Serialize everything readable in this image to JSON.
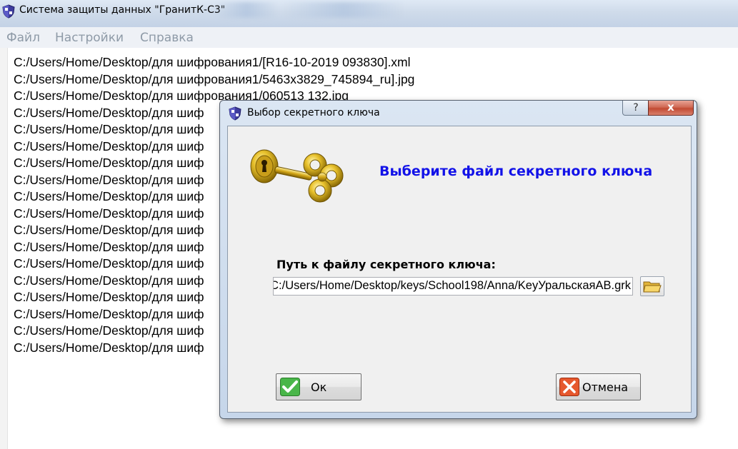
{
  "window": {
    "title": "Система защиты данных \"ГранитК-С3\""
  },
  "menu": [
    {
      "label": "Файл"
    },
    {
      "label": "Настройки"
    },
    {
      "label": "Справка"
    }
  ],
  "files": [
    "C:/Users/Home/Desktop/для шифрования1/[R16-10-2019 093830].xml",
    "C:/Users/Home/Desktop/для шифрования1/5463x3829_745894_ru].jpg",
    "C:/Users/Home/Desktop/для шифрования1/060513 132.jpg",
    "C:/Users/Home/Desktop/для шиф",
    "C:/Users/Home/Desktop/для шиф",
    "C:/Users/Home/Desktop/для шиф",
    "C:/Users/Home/Desktop/для шиф",
    "C:/Users/Home/Desktop/для шиф",
    "C:/Users/Home/Desktop/для шиф",
    "C:/Users/Home/Desktop/для шиф",
    "C:/Users/Home/Desktop/для шиф",
    "C:/Users/Home/Desktop/для шиф",
    "C:/Users/Home/Desktop/для шиф",
    "C:/Users/Home/Desktop/для шиф",
    "C:/Users/Home/Desktop/для шиф",
    "C:/Users/Home/Desktop/для шиф",
    "C:/Users/Home/Desktop/для шиф",
    "C:/Users/Home/Desktop/для шиф"
  ],
  "dialog": {
    "title": "Выбор секретного ключа",
    "help_label": "?",
    "close_label": "x",
    "heading": "Выберите файл секретного ключа",
    "path_label": "Путь к файлу секретного ключа:",
    "path_value": "C:/Users/Home/Desktop/keys/School198/Anna/KeyУральскаяАВ.grk",
    "ok_label": "Ок",
    "cancel_label": "Отмена"
  },
  "icons": {
    "app": "shield-icon",
    "key": "golden-key-icon",
    "browse": "folder-icon",
    "ok": "checkmark-icon",
    "cancel": "x-icon"
  },
  "colors": {
    "heading": "#1212e8",
    "menu_text": "#8e9aa7",
    "close_button": "#c24a33",
    "ok_icon": "#3aa83a",
    "cancel_icon": "#e0502c"
  }
}
